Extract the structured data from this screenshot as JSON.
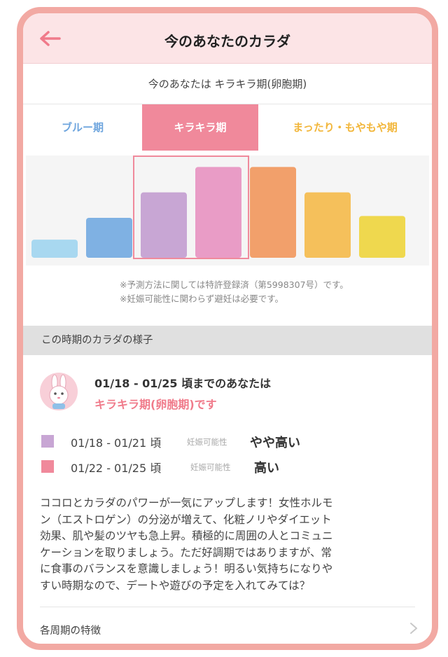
{
  "header": {
    "title": "今のあなたのカラダ",
    "back_icon": "left-arrow-icon",
    "accent": "#f07a8a"
  },
  "status": {
    "text": "今のあなたは キラキラ期(卵胞期)"
  },
  "tabs": [
    {
      "label": "ブルー期",
      "color": "#6ea5de",
      "active": false
    },
    {
      "label": "キラキラ期",
      "color": "#f0899b",
      "active": true
    },
    {
      "label": "まったり・もやもや期",
      "color": "#f2b63a",
      "active": false
    }
  ],
  "chart_data": {
    "type": "bar",
    "categories": [
      "",
      "",
      "",
      "",
      "",
      "",
      ""
    ],
    "values": [
      1,
      2.2,
      3.6,
      5,
      5,
      3.6,
      2.3
    ],
    "colors": [
      "#a8d8f0",
      "#7fb1e3",
      "#c8a6d4",
      "#e99cc6",
      "#f2a06b",
      "#f5c05b",
      "#efd84e"
    ],
    "highlight": [
      2,
      3
    ],
    "ylim": [
      0,
      5.4
    ],
    "grid": false
  },
  "notes": [
    "※予測方法に関しては特許登録済（第5998307号）です。",
    "※妊娠可能性に関わらず避妊は必要です。"
  ],
  "section": {
    "title": "この時期のカラダの様子"
  },
  "summary": {
    "avatar_icon": "bunny-avatar-icon",
    "date_text": "01/18 - 01/25 頃までのあなたは",
    "phase_text": "キラキラ期(卵胞期)です"
  },
  "ranges": [
    {
      "date": "01/18 - 01/21 頃",
      "label": "妊娠可能性",
      "level": "やや高い",
      "color": "#c8a6d4"
    },
    {
      "date": "01/22 - 01/25 頃",
      "label": "妊娠可能性",
      "level": "高い",
      "color": "#f0899b"
    }
  ],
  "description": [
    "ココロとカラダのパワーが一気にアップします！女性ホルモ",
    "ン（エストロゲン）の分泌が増えて、化粧ノリやダイエット",
    "効果、肌や髪のツヤも急上昇。積極的に周囲の人とコミュニ",
    "ケーションを取りましょう。ただ好調期ではありますが、常",
    "に食事のバランスを意識しましょう！明るい気持ちになりや",
    "すい時期なので、デートや遊びの予定を入れてみては？"
  ],
  "footer": {
    "label": "各周期の特徴",
    "chevron_icon": "chevron-right-icon"
  }
}
